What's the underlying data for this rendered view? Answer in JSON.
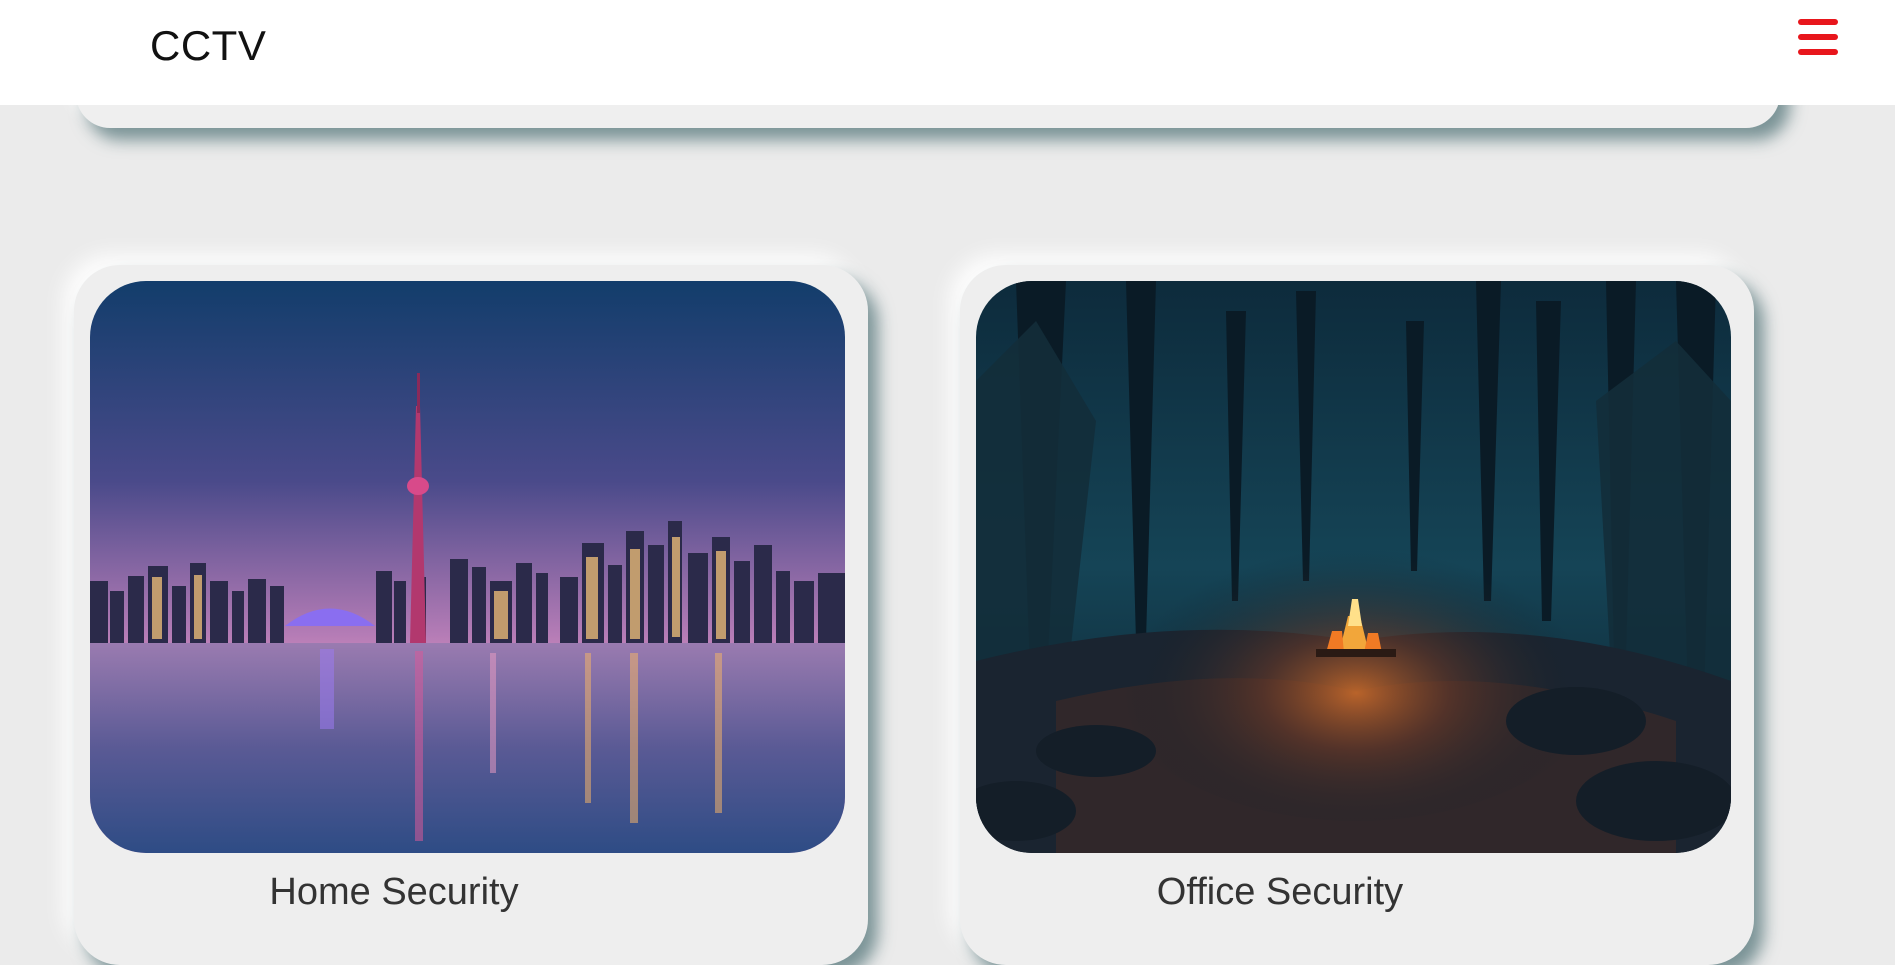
{
  "navbar": {
    "brand": "CCTV",
    "menu_icon": "hamburger-menu-icon",
    "menu_color": "#e8161c"
  },
  "cards": [
    {
      "title": "Home Security",
      "image": "city-skyline-at-dusk-photo"
    },
    {
      "title": "Office Security",
      "image": "campfire-in-night-forest-photo"
    }
  ],
  "colors": {
    "background": "#ebebeb",
    "card": "#eeeeee",
    "shadow": "#3e6468"
  }
}
